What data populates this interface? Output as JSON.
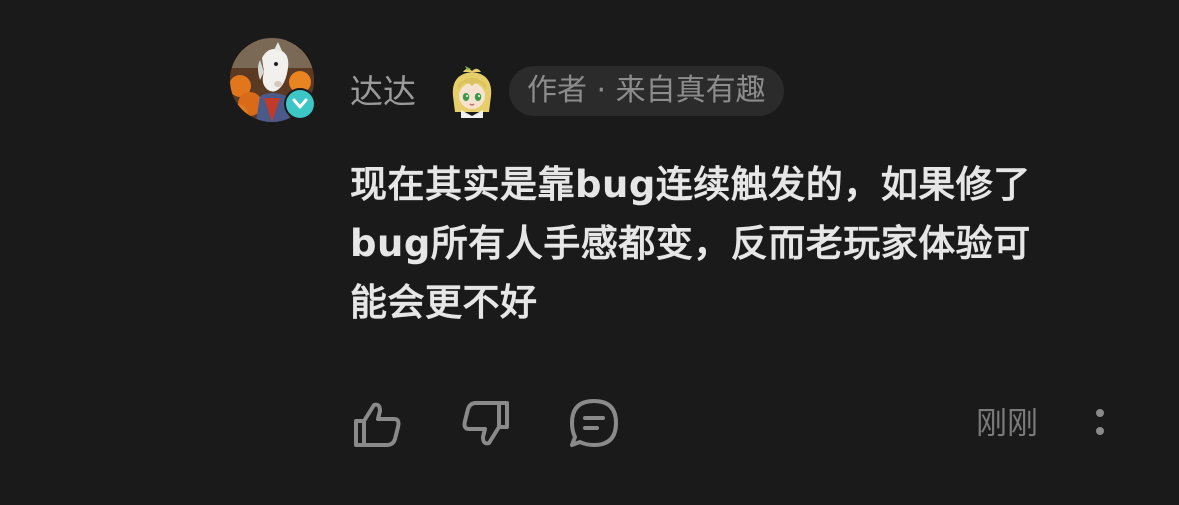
{
  "comment": {
    "user": {
      "name": "达达",
      "avatar_icon": "horse-mask-avatar",
      "badge_icon": "verified-check-icon",
      "pendant_icon": "anime-character-pendant",
      "tag": "作者 · 来自真有趣"
    },
    "body_lines": [
      "现在其实是靠bug连续触发的，如果修了",
      "bug所有人手感都变，反而老玩家体验可",
      "能会更不好"
    ],
    "actions": {
      "like_icon": "thumbs-up-icon",
      "dislike_icon": "thumbs-down-icon",
      "reply_icon": "comment-bubble-icon",
      "more_icon": "more-vertical-icon"
    },
    "timestamp": "刚刚"
  },
  "colors": {
    "background": "#1a1a1a",
    "text_primary": "#e6e6e6",
    "text_secondary": "#9a9a9a",
    "tag_bg": "#2b2b2b",
    "badge": "#3cc6c6",
    "icon": "#8a8a8a"
  }
}
